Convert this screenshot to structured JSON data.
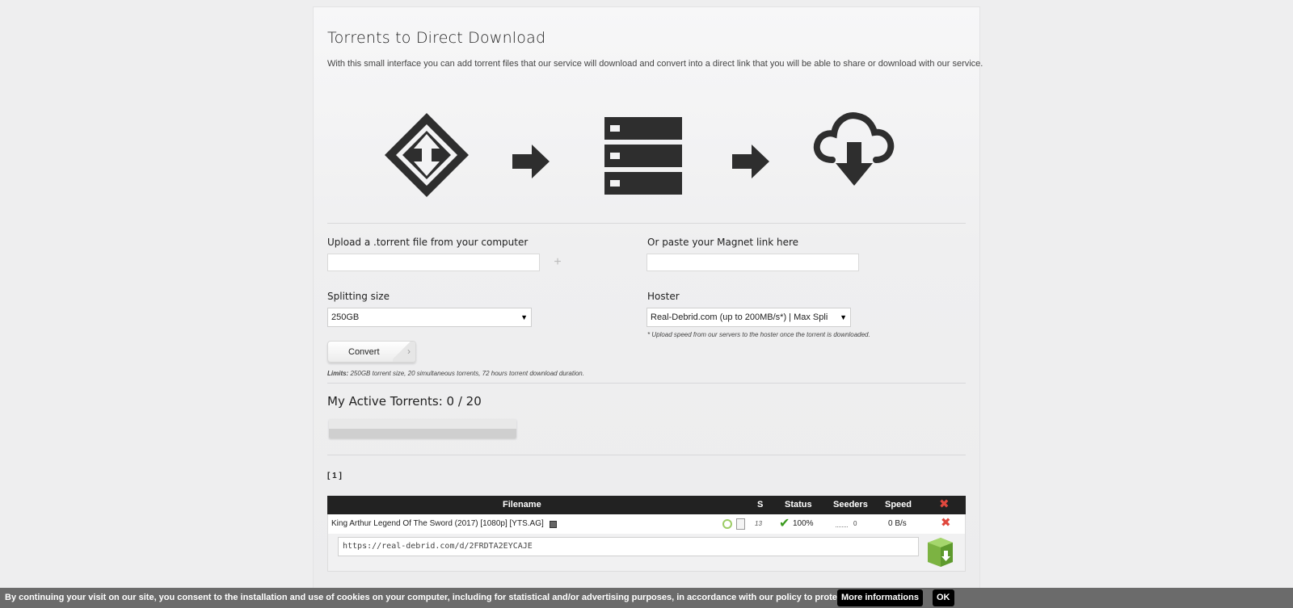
{
  "page": {
    "title": "Torrents to Direct Download",
    "intro": "With this small interface you can add torrent files that our service will download and convert into a direct link that you will be able to share or download with our service."
  },
  "icons": [
    "torrent-icon",
    "arrow-right-icon",
    "server-icon",
    "arrow-right-icon",
    "cloud-download-icon"
  ],
  "form": {
    "upload_label": "Upload a .torrent file from your computer",
    "upload_value": "",
    "add_icon": "plus-icon",
    "magnet_label": "Or paste your Magnet link here",
    "magnet_value": "",
    "split_label": "Splitting size",
    "split_value": "250GB",
    "hoster_label": "Hoster",
    "hoster_value": "Real-Debrid.com (up to 200MB/s*) | Max Spli",
    "hoster_note": "* Upload speed from our servers to the hoster once the torrent is downloaded.",
    "convert_label": "Convert",
    "limits_label": "Limits:",
    "limits_text": "250GB torrent size, 20 simultaneous torrents, 72 hours torrent download duration."
  },
  "active": {
    "title": "My Active Torrents: 0 / 20",
    "usage_fraction": 0.0
  },
  "pager": "[ 1 ]",
  "table": {
    "headers": {
      "filename": "Filename",
      "s": "S",
      "status": "Status",
      "seeders": "Seeders",
      "speed": "Speed"
    },
    "rows": [
      {
        "filename": "King Arthur Legend Of The Sword (2017) [1080p] [YTS.AG]",
        "s": "13",
        "status": "100%",
        "seeders": "0",
        "speed": "0 B/s",
        "link": "https://real-debrid.com/d/2FRDTA2EYCAJE"
      }
    ]
  },
  "cookie": {
    "message": "By continuing your visit on our site, you consent to the installation and use of cookies on your computer, including for statistical and/or advertising purposes, in accordance with our policy to protect your privacy",
    "more": "More informations",
    "ok": "OK"
  },
  "colors": {
    "header_bg": "#222222",
    "delete_red": "#e0483e",
    "check_green": "#3a9a1e",
    "download_box_green": "#7cb342",
    "cookie_bar": "#6b6b6b"
  }
}
